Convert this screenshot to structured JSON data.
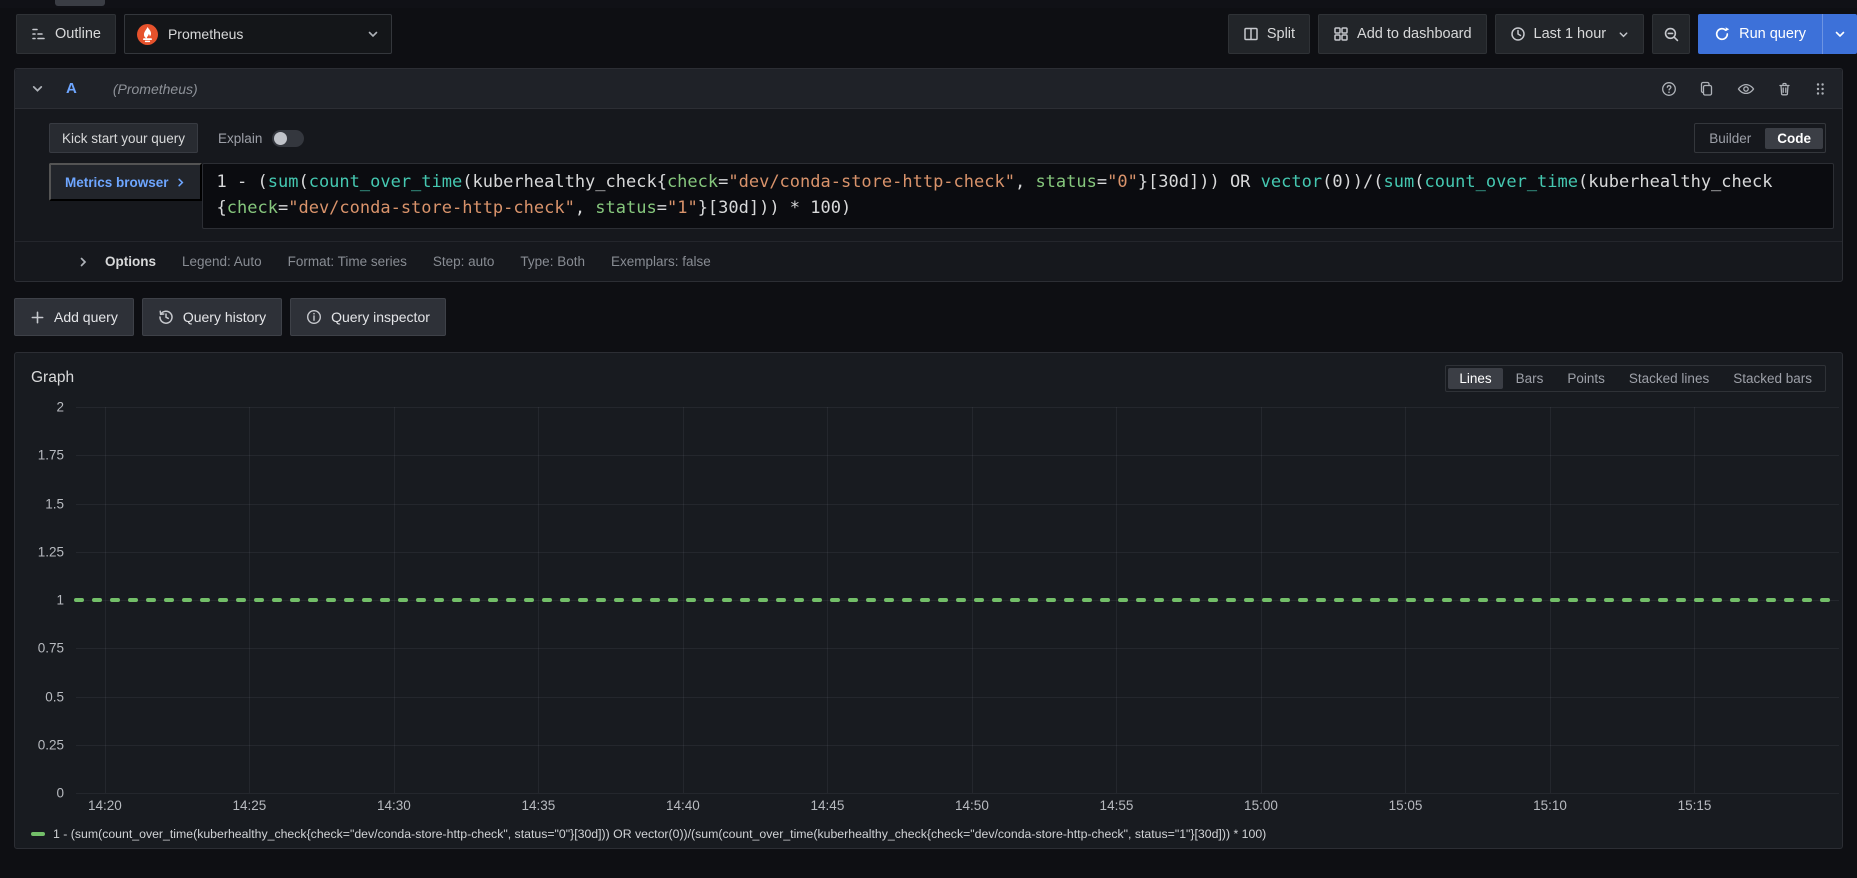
{
  "toolbar": {
    "outline": "Outline",
    "datasource": "Prometheus",
    "split": "Split",
    "add_to_dashboard": "Add to dashboard",
    "time_range": "Last 1 hour",
    "run_query": "Run query"
  },
  "query_row": {
    "ref_id": "A",
    "datasource_hint": "(Prometheus)"
  },
  "query_editor": {
    "kick_start": "Kick start your query",
    "explain": "Explain",
    "explain_enabled": false,
    "builder": "Builder",
    "code": "Code",
    "active_editor": "Code",
    "metrics_browser": "Metrics browser",
    "code_lines": [
      [
        [
          "p",
          "1 - ("
        ],
        [
          "f",
          "sum"
        ],
        [
          "p",
          "("
        ],
        [
          "f",
          "count_over_time"
        ],
        [
          "p",
          "(kuberhealthy_check{"
        ],
        [
          "l",
          "check"
        ],
        [
          "p",
          "="
        ],
        [
          "s",
          "\"dev/conda-store-http-check\""
        ],
        [
          "p",
          ", "
        ],
        [
          "l",
          "status"
        ],
        [
          "p",
          "="
        ],
        [
          "s",
          "\"0\""
        ],
        [
          "p",
          "}[30d])) OR "
        ],
        [
          "f",
          "vector"
        ],
        [
          "p",
          "(0))/("
        ],
        [
          "f",
          "sum"
        ],
        [
          "p",
          "("
        ],
        [
          "f",
          "count_over_time"
        ],
        [
          "p",
          "(kuberhealthy_check"
        ]
      ],
      [
        [
          "p",
          "{"
        ],
        [
          "l",
          "check"
        ],
        [
          "p",
          "="
        ],
        [
          "s",
          "\"dev/conda-store-http-check\""
        ],
        [
          "p",
          ", "
        ],
        [
          "l",
          "status"
        ],
        [
          "p",
          "="
        ],
        [
          "s",
          "\"1\""
        ],
        [
          "p",
          "}[30d])) * 100)"
        ]
      ]
    ]
  },
  "options_row": {
    "label": "Options",
    "items": [
      "Legend: Auto",
      "Format: Time series",
      "Step: auto",
      "Type: Both",
      "Exemplars: false"
    ]
  },
  "actions": {
    "add_query": "Add query",
    "query_history": "Query history",
    "query_inspector": "Query inspector"
  },
  "graph": {
    "title": "Graph",
    "modes": [
      "Lines",
      "Bars",
      "Points",
      "Stacked lines",
      "Stacked bars"
    ],
    "active_mode": "Lines"
  },
  "chart_data": {
    "type": "line",
    "title": "Graph",
    "grid": true,
    "legend_position": "bottom",
    "x_axis": {
      "unit": "time-of-day",
      "min_minutes": 859,
      "max_minutes": 920,
      "ticks": [
        {
          "minutes": 860,
          "label": "14:20"
        },
        {
          "minutes": 865,
          "label": "14:25"
        },
        {
          "minutes": 870,
          "label": "14:30"
        },
        {
          "minutes": 875,
          "label": "14:35"
        },
        {
          "minutes": 880,
          "label": "14:40"
        },
        {
          "minutes": 885,
          "label": "14:45"
        },
        {
          "minutes": 890,
          "label": "14:50"
        },
        {
          "minutes": 895,
          "label": "14:55"
        },
        {
          "minutes": 900,
          "label": "15:00"
        },
        {
          "minutes": 905,
          "label": "15:05"
        },
        {
          "minutes": 910,
          "label": "15:10"
        },
        {
          "minutes": 915,
          "label": "15:15"
        }
      ]
    },
    "y_axis": {
      "min": 0,
      "max": 2,
      "ticks": [
        2,
        1.75,
        1.5,
        1.25,
        1,
        0.75,
        0.5,
        0.25,
        0
      ],
      "tick_labels": [
        "2",
        "1.75",
        "1.5",
        "1.25",
        "1",
        "0.75",
        "0.5",
        "0.25",
        "0"
      ]
    },
    "series": [
      {
        "name": "1 - (sum(count_over_time(kuberhealthy_check{check=\"dev/conda-store-http-check\", status=\"0\"}[30d])) OR vector(0))/(sum(count_over_time(kuberhealthy_check{check=\"dev/conda-store-http-check\", status=\"1\"}[30d])) * 100)",
        "color": "#73bf69",
        "line_style": "dashed",
        "value_constant": 1,
        "x_start_minutes": 859,
        "x_end_minutes": 920
      }
    ]
  },
  "icons": {
    "outline": "list-outline",
    "datasource": "prometheus-flame",
    "split": "split-columns",
    "add_to_dashboard": "apps-grid",
    "time_range": "clock",
    "zoom_out": "search-minus",
    "run_query": "sync-arrows",
    "help": "question-circle",
    "duplicate": "copy",
    "visibility": "eye",
    "remove": "trash",
    "drag": "grip-dots",
    "collapse": "chevron-down",
    "options_expand": "chevron-right",
    "add": "plus",
    "history": "history-clock",
    "inspector": "info-circle"
  },
  "colors": {
    "accent_blue": "#3d71d9",
    "link_blue": "#6ea6ff",
    "series_green": "#73bf69",
    "prometheus_orange": "#e6522c"
  }
}
